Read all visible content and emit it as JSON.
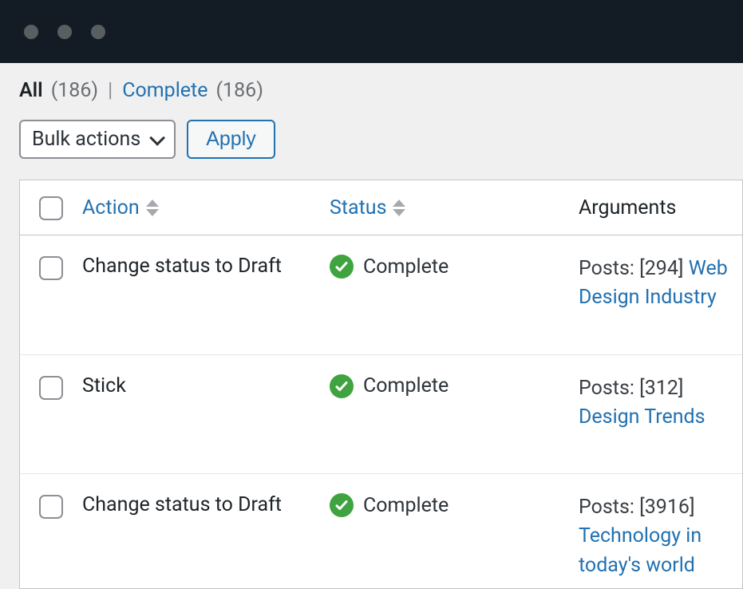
{
  "filters": {
    "all_label": "All",
    "all_count": "(186)",
    "separator": "|",
    "complete_label": "Complete",
    "complete_count": "(186)"
  },
  "toolbar": {
    "bulk_label": "Bulk actions",
    "apply_label": "Apply"
  },
  "columns": {
    "action": "Action",
    "status": "Status",
    "arguments": "Arguments"
  },
  "status_labels": {
    "complete": "Complete"
  },
  "rows": [
    {
      "action": "Change status to Draft",
      "status": "complete",
      "args_prefix": "Posts: [294] ",
      "args_link": "Web Design Industry"
    },
    {
      "action": "Stick",
      "status": "complete",
      "args_prefix": "Posts: [312] ",
      "args_link": "Design Trends"
    },
    {
      "action": "Change status to Draft",
      "status": "complete",
      "args_prefix": "Posts: [3916] ",
      "args_link": "Technology in today's world"
    }
  ]
}
